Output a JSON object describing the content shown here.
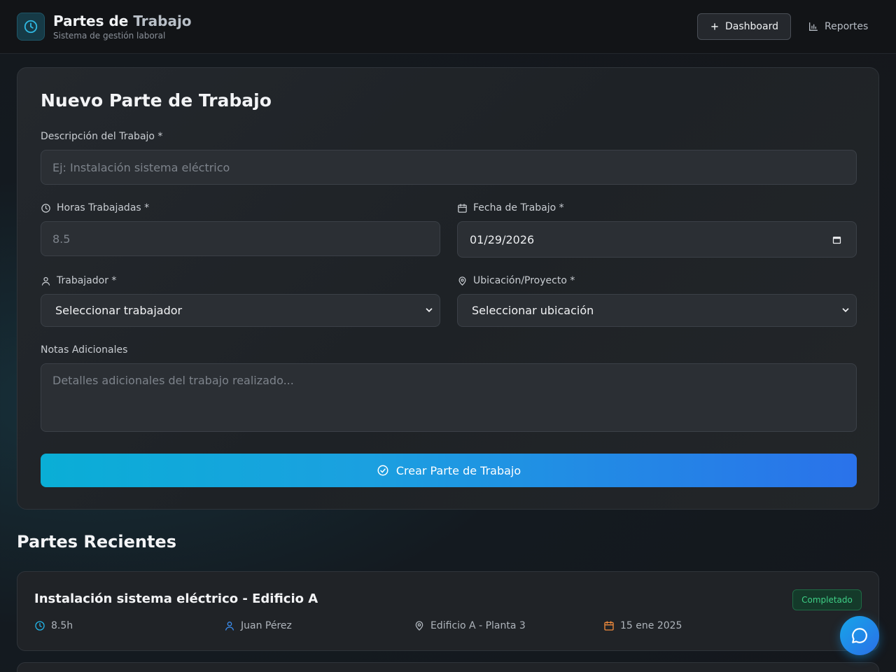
{
  "header": {
    "title_main": "Partes de ",
    "title_accent": "Trabajo",
    "subtitle": "Sistema de gestión laboral",
    "nav": {
      "dashboard_label": "Dashboard",
      "reportes_label": "Reportes"
    }
  },
  "form": {
    "title": "Nuevo Parte de Trabajo",
    "descripcion": {
      "label": "Descripción del Trabajo *",
      "placeholder": "Ej: Instalación sistema eléctrico"
    },
    "horas": {
      "label": "Horas Trabajadas *",
      "placeholder": "8.5"
    },
    "fecha": {
      "label": "Fecha de Trabajo *",
      "value": "01/29/2026"
    },
    "trabajador": {
      "label": "Trabajador *",
      "selected": "Seleccionar trabajador"
    },
    "ubicacion": {
      "label": "Ubicación/Proyecto *",
      "selected": "Seleccionar ubicación"
    },
    "notas": {
      "label": "Notas Adicionales",
      "placeholder": "Detalles adicionales del trabajo realizado..."
    },
    "submit_label": "Crear Parte de Trabajo"
  },
  "recent": {
    "title": "Partes Recientes",
    "items": [
      {
        "title": "Instalación sistema eléctrico - Edificio A",
        "status": "Completado",
        "hours": "8.5h",
        "worker": "Juan Pérez",
        "location": "Edificio A - Planta 3",
        "date": "15 ene 2025"
      }
    ]
  },
  "icons": {
    "logo": "clock-icon",
    "dashboard": "plus-icon",
    "reportes": "bar-chart-icon",
    "horas": "clock-icon",
    "fecha": "calendar-icon",
    "trabajador": "user-icon",
    "ubicacion": "map-pin-icon",
    "submit": "check-circle-icon",
    "chat": "chat-bubble-icon"
  },
  "colors": {
    "accent": "#0aaed6",
    "accent_end": "#2a72ea",
    "status_completed": "#3fcf86",
    "date_icon": "#f08a3c"
  }
}
